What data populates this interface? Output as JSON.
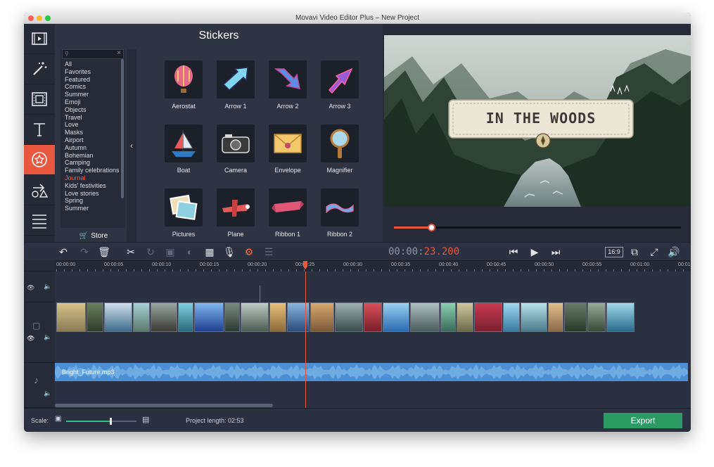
{
  "window": {
    "title": "Movavi Video Editor Plus – New Project"
  },
  "sidebar": {
    "items": [
      {
        "name": "import-media",
        "icon": "film-import-icon"
      },
      {
        "name": "filters",
        "icon": "magic-wand-icon"
      },
      {
        "name": "transitions",
        "icon": "film-frames-icon"
      },
      {
        "name": "titles",
        "icon": "text-t-icon"
      },
      {
        "name": "stickers",
        "icon": "sticker-star-icon",
        "active": true
      },
      {
        "name": "callouts",
        "icon": "shapes-arrow-icon"
      },
      {
        "name": "more-tools",
        "icon": "menu-list-icon"
      }
    ]
  },
  "stickers_panel": {
    "title": "Stickers",
    "categories": [
      "All",
      "Favorites",
      "Featured",
      "Comics",
      "Summer",
      "Emoji",
      "Objects",
      "Travel",
      "Love",
      "Masks",
      "Airport",
      "Autumn",
      "Bohemian",
      "Camping",
      "Family celebrations",
      "Journal",
      "Kids' festivities",
      "Love stories",
      "Spring",
      "Summer"
    ],
    "selected_category": "Journal",
    "store_label": "Store",
    "items": [
      {
        "label": "Aerostat"
      },
      {
        "label": "Arrow 1"
      },
      {
        "label": "Arrow 2"
      },
      {
        "label": "Arrow 3"
      },
      {
        "label": "Boat"
      },
      {
        "label": "Camera"
      },
      {
        "label": "Envelope"
      },
      {
        "label": "Magnifier"
      },
      {
        "label": "Pictures"
      },
      {
        "label": "Plane"
      },
      {
        "label": "Ribbon 1"
      },
      {
        "label": "Ribbon 2"
      }
    ]
  },
  "preview": {
    "title_text": "IN THE WOODS",
    "progress": 0.13
  },
  "toolbar": {
    "timecode_dim": "00:00:",
    "timecode_hot": "23.200",
    "aspect": "16:9",
    "accent": "#e8573f"
  },
  "timeline": {
    "ticks": [
      "00:00:00",
      "00:00:05",
      "00:00:10",
      "00:00:15",
      "00:00:20",
      "00:00:25",
      "00:00:30",
      "00:00:35",
      "00:00:40",
      "00:00:45",
      "00:00:50",
      "00:00:55",
      "00:01:00",
      "00:01:"
    ],
    "audio_clip": "Bright_Future.mp3"
  },
  "status": {
    "scale_label": "Scale:",
    "scale_value": 0.62,
    "project_length": "Project length:  02:53",
    "export_label": "Export"
  }
}
